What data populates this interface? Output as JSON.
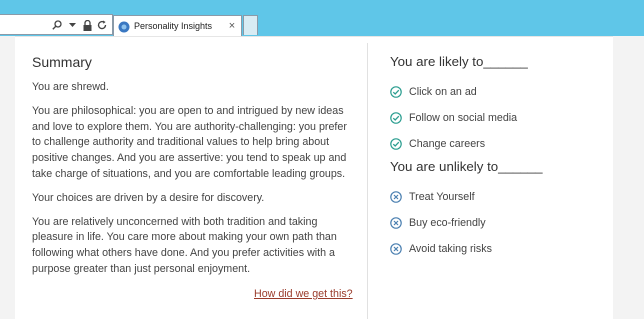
{
  "browser": {
    "tab_title": "Personality Insights",
    "tab_close": "×"
  },
  "summary": {
    "heading": "Summary",
    "paragraphs": [
      "You are shrewd.",
      "You are philosophical: you are open to and intrigued by new ideas and love to explore them. You are authority-challenging: you prefer to challenge authority and traditional values to help bring about positive changes. And you are assertive: you tend to speak up and take charge of situations, and you are comfortable leading groups.",
      "Your choices are driven by a desire for discovery.",
      "You are relatively unconcerned with both tradition and taking pleasure in life. You care more about making your own path than following what others have done. And you prefer activities with a purpose greater than just personal enjoyment."
    ],
    "link": "How did we get this?"
  },
  "likely": {
    "heading": "You are likely to______",
    "items": [
      "Click on an ad",
      "Follow on social media",
      "Change careers"
    ],
    "icon": "check-circle-icon",
    "color": "#2a9d8f"
  },
  "unlikely": {
    "heading": "You are unlikely to______",
    "items": [
      "Treat Yourself",
      "Buy eco-friendly",
      "Avoid taking risks"
    ],
    "icon": "x-circle-icon",
    "color": "#4a7fb0"
  }
}
